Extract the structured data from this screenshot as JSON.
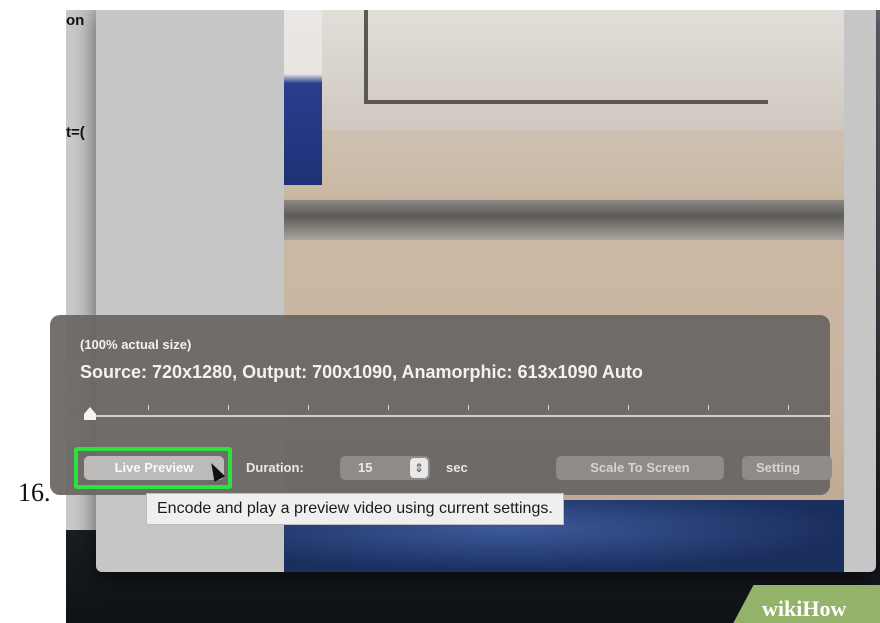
{
  "step_number": "16.",
  "background_window": {
    "partial_texts": [
      "on",
      "t=("
    ]
  },
  "preview_window": {
    "size_note": "(100% actual size)",
    "source_info": "Source: 720x1280, Output: 700x1090, Anamorphic: 613x1090 Auto",
    "slider": {
      "position": 0
    },
    "live_preview_label": "Live Preview",
    "duration_label": "Duration:",
    "duration_value": "15",
    "duration_unit": "sec",
    "scale_to_screen_label": "Scale To Screen",
    "settings_label": "Setting",
    "tooltip": "Encode and play a preview video using current settings."
  },
  "watermark": {
    "prefix": "wiki",
    "suffix": "How"
  },
  "colors": {
    "highlight": "#2ee23d",
    "hud_background": "#69655f",
    "watermark": "#93b26a"
  }
}
